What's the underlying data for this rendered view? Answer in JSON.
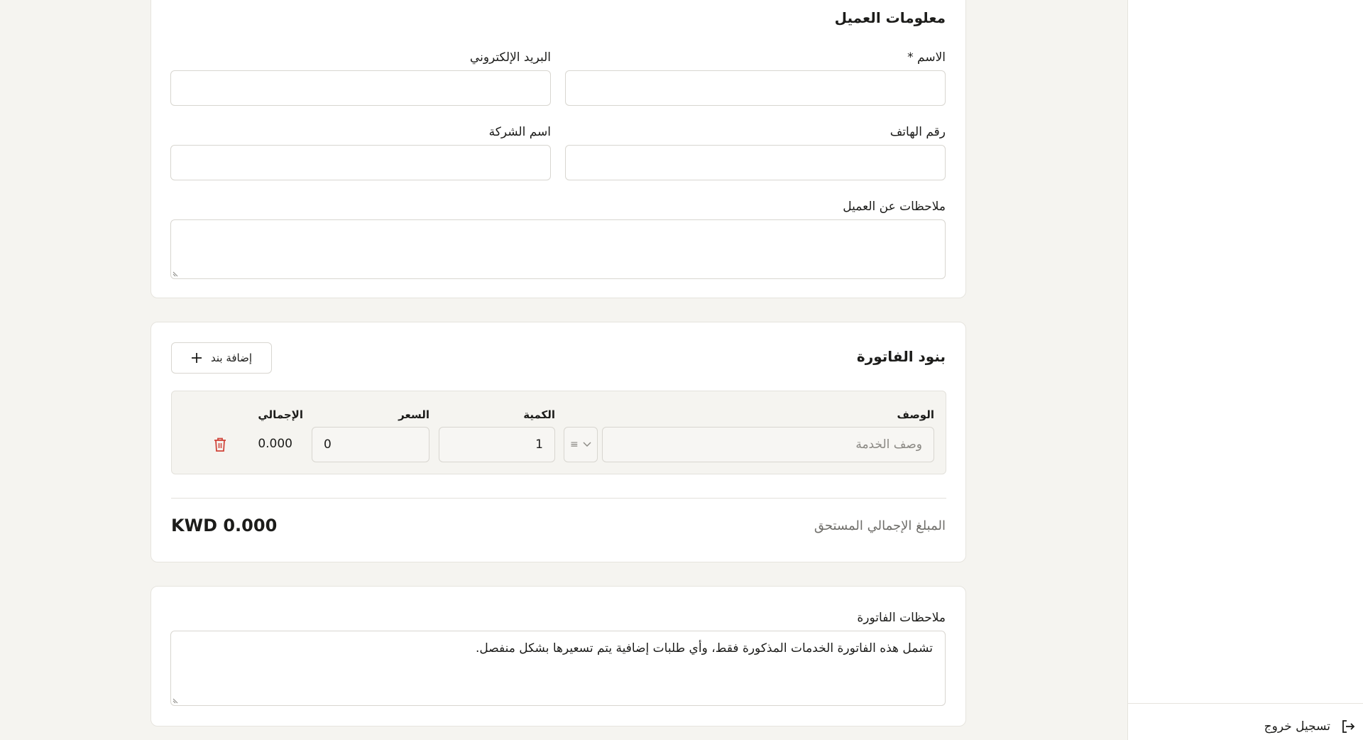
{
  "customer_info": {
    "title": "معلومات العميل",
    "name_label": "الاسم *",
    "email_label": "البريد الإلكتروني",
    "phone_label": "رقم الهاتف",
    "company_label": "اسم الشركة",
    "notes_label": "ملاحظات عن العميل",
    "name_value": "",
    "email_value": "",
    "phone_value": "",
    "company_value": "",
    "notes_value": ""
  },
  "invoice_items": {
    "title": "بنود الفاتورة",
    "add_button_label": "إضافة بند",
    "columns": {
      "description": "الوصف",
      "quantity": "الكمية",
      "price": "السعر",
      "total": "الإجمالي"
    },
    "rows": [
      {
        "description_placeholder": "وصف الخدمة",
        "unit_selector": "≡",
        "quantity": "1",
        "price": "0",
        "total": "0.000"
      }
    ],
    "total_label": "المبلغ الإجمالي المستحق",
    "total_value": "KWD 0.000"
  },
  "invoice_notes": {
    "title": "ملاحظات الفاتورة",
    "value": "تشمل هذه الفاتورة الخدمات المذكورة فقط، وأي طلبات إضافية يتم تسعيرها بشكل منفصل."
  },
  "sidebar": {
    "logout_label": "تسجيل خروج"
  },
  "colors": {
    "background": "#f5f4f0",
    "card": "#ffffff",
    "border": "#d8d6d0",
    "delete": "#d0443a",
    "muted_text": "#6f6e6a"
  }
}
